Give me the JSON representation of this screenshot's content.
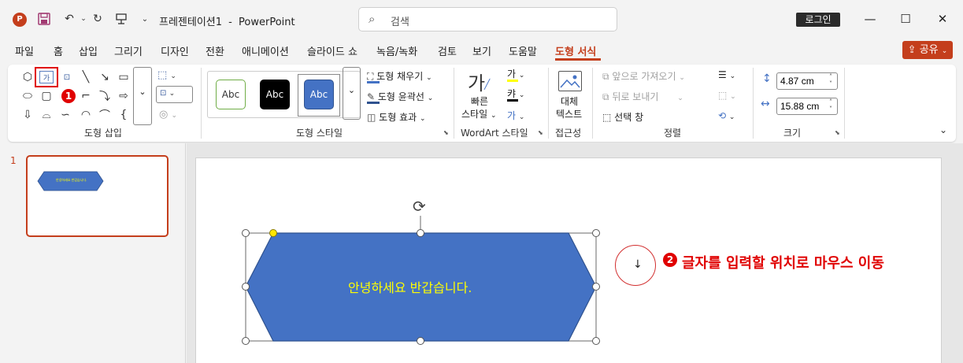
{
  "app": {
    "doc_title": "프레젠테이션1",
    "separator": "-",
    "app_name": "PowerPoint",
    "search_placeholder": "검색",
    "login_label": "로그인"
  },
  "menu": {
    "tabs": [
      "파일",
      "홈",
      "삽입",
      "그리기",
      "디자인",
      "전환",
      "애니메이션",
      "슬라이드 쇼",
      "녹음/녹화",
      "검토",
      "보기",
      "도움말",
      "도형 서식"
    ],
    "share_label": "공유"
  },
  "ribbon": {
    "groups": {
      "insert_shapes": "도형 삽입",
      "shape_styles": "도형 스타일",
      "wordart_styles": "WordArt 스타일",
      "accessibility": "접근성",
      "arrange": "정렬",
      "size": "크기"
    },
    "style_swatch_label": "Abc",
    "fill_label": "도형 채우기",
    "outline_label": "도형 윤곽선",
    "effects_label": "도형 효과",
    "quick_styles_line1": "빠른",
    "quick_styles_line2": "스타일",
    "wordart_glyph": "가",
    "wordart_glyph2": "캬",
    "alt_text_line1": "대체",
    "alt_text_line2": "텍스트",
    "bring_forward": "앞으로 가져오기",
    "send_backward": "뒤로 보내기",
    "selection_pane": "선택 창",
    "height_value": "4.87 cm",
    "width_value": "15.88 cm"
  },
  "slides": {
    "number": "1"
  },
  "slide": {
    "shape_text": "안녕하세요 반갑습니다.",
    "shape_fill": "#4472c4",
    "shape_text_color": "#ffff00"
  },
  "annotations": {
    "badge1": "1",
    "badge2": "2",
    "instruction": "글자를 입력할 위치로 마우스 이동"
  },
  "colors": {
    "accent": "#c43e1c",
    "annotation_red": "#e00000"
  }
}
